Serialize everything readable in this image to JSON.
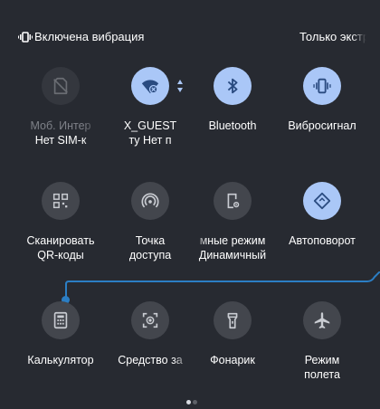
{
  "status_bar": {
    "left_text": "Включена вибрация",
    "right_text": "Только экстр"
  },
  "tiles": [
    {
      "label": "Моб. Интер",
      "sub": "Нет SIM-к",
      "state": "disabled",
      "icon": "no-sim-icon"
    },
    {
      "label": "X_GUEST",
      "sub": "ту     Нет п",
      "state": "active",
      "icon": "wifi-off-icon"
    },
    {
      "label": "Bluetooth",
      "state": "active",
      "icon": "bluetooth-icon"
    },
    {
      "label": "Вибросигнал",
      "state": "active",
      "icon": "vibrate-icon"
    },
    {
      "label": "Сканировать",
      "sub": "QR-коды",
      "state": "inactive",
      "icon": "qr-code-icon"
    },
    {
      "label": "Точка",
      "sub": "доступа",
      "state": "inactive",
      "icon": "hotspot-icon"
    },
    {
      "label": "мные режим",
      "sub": "Динамичный",
      "state": "inactive",
      "icon": "device-settings-icon"
    },
    {
      "label": "Автоповорот",
      "state": "active",
      "icon": "auto-rotate-icon"
    },
    {
      "label": "Калькулятор",
      "state": "inactive",
      "icon": "calculator-icon"
    },
    {
      "label": "Средство за",
      "state": "inactive",
      "icon": "screen-record-icon"
    },
    {
      "label": "Фонарик",
      "state": "inactive",
      "icon": "flashlight-icon"
    },
    {
      "label": "Режим",
      "sub": "полета",
      "state": "inactive",
      "icon": "airplane-icon"
    }
  ],
  "colors": {
    "background": "#272a31",
    "tile_inactive": "#43464d",
    "tile_active": "#aac7f7",
    "hint_line": "#2b7ec4"
  }
}
